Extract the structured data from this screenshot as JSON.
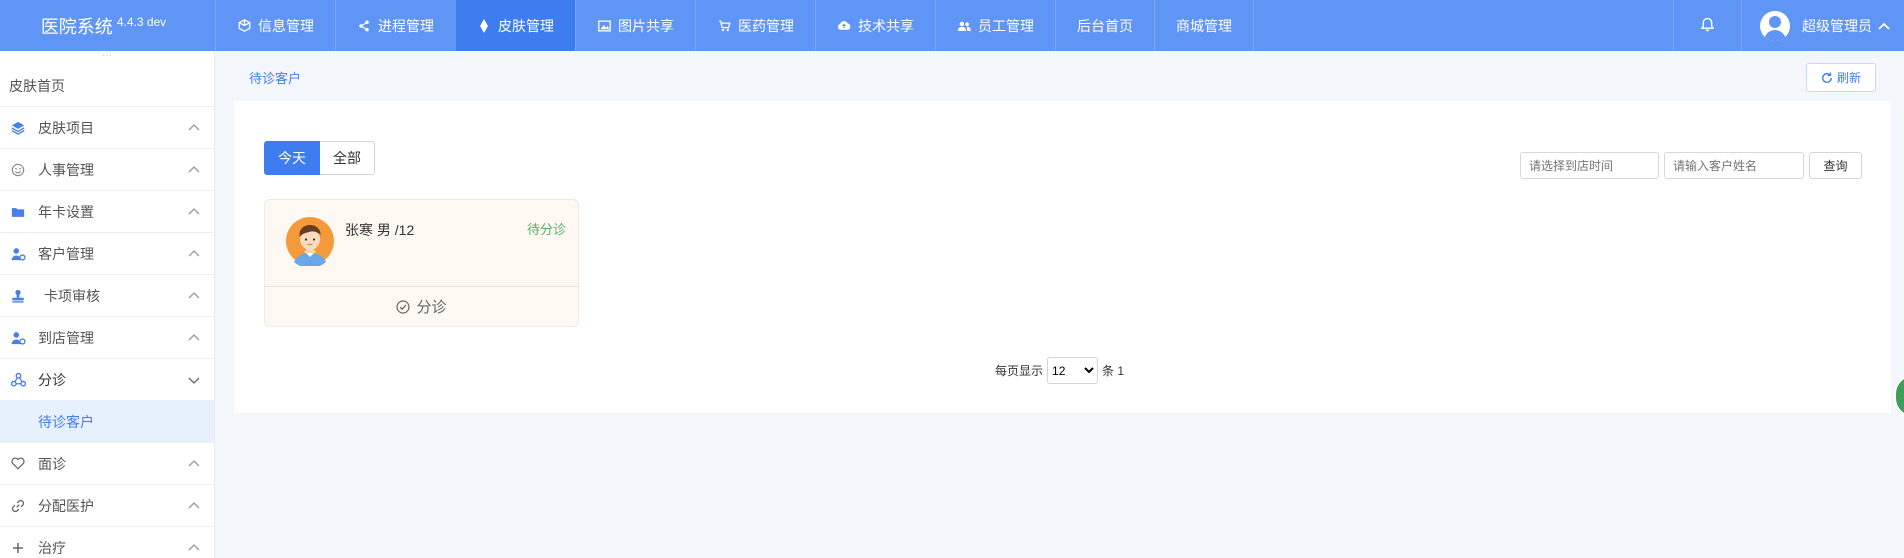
{
  "app": {
    "name": "医院系统",
    "version": "4.4.3 dev"
  },
  "nav": [
    {
      "label": "信息管理",
      "icon": "cube-icon",
      "active": false
    },
    {
      "label": "进程管理",
      "icon": "share-icon",
      "active": false
    },
    {
      "label": "皮肤管理",
      "icon": "drop-icon",
      "active": true
    },
    {
      "label": "图片共享",
      "icon": "image-icon",
      "active": false
    },
    {
      "label": "医药管理",
      "icon": "cart-icon",
      "active": false
    },
    {
      "label": "技术共享",
      "icon": "cloud-upload-icon",
      "active": false
    },
    {
      "label": "员工管理",
      "icon": "users-icon",
      "active": false
    },
    {
      "label": "后台首页",
      "icon": "",
      "active": false
    },
    {
      "label": "商城管理",
      "icon": "",
      "active": false
    }
  ],
  "user": {
    "name": "超级管理员"
  },
  "sidebar": {
    "home": "皮肤首页",
    "items": [
      {
        "label": "皮肤项目",
        "icon": "layers-icon"
      },
      {
        "label": "人事管理",
        "icon": "smile-icon"
      },
      {
        "label": "年卡设置",
        "icon": "folder-icon"
      },
      {
        "label": "客户管理",
        "icon": "user-gear-icon"
      },
      {
        "label": "卡项审核",
        "icon": "stamp-icon"
      },
      {
        "label": "到店管理",
        "icon": "user-gear-icon"
      },
      {
        "label": "分诊",
        "icon": "triangle-nodes-icon",
        "open": true
      },
      {
        "label": "面诊",
        "icon": "heart-icon"
      },
      {
        "label": "分配医护",
        "icon": "link-icon"
      },
      {
        "label": "治疗",
        "icon": "plus-icon"
      }
    ],
    "sub_item": "待诊客户"
  },
  "breadcrumb": "待诊客户",
  "refresh_label": "刷新",
  "tabs": {
    "today": "今天",
    "all": "全部"
  },
  "filters": {
    "date_placeholder": "请选择到店时间",
    "name_placeholder": "请输入客户姓名",
    "query_label": "查询"
  },
  "card": {
    "title": "张寒 男 /12",
    "status": "待分诊",
    "action": "分诊"
  },
  "pager": {
    "prefix": "每页显示",
    "size": "12",
    "suffix": "条 1"
  },
  "colors": {
    "topbar": "#5f95f5",
    "active_nav": "#3d7df0",
    "status_green": "#52b36b",
    "accent": "#3d7df0"
  }
}
